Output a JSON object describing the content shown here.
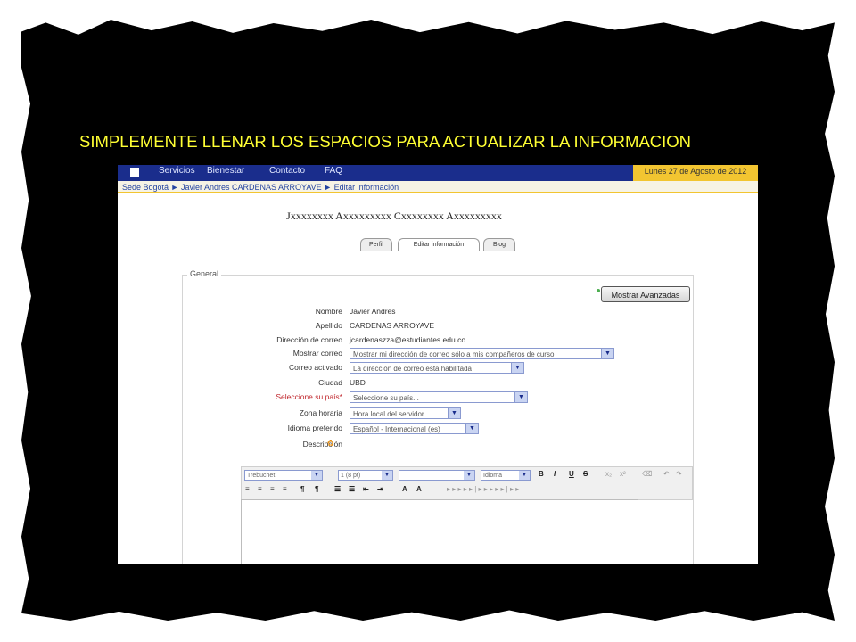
{
  "slide": {
    "title": "SIMPLEMENTE LLENAR LOS ESPACIOS PARA ACTUALIZAR LA INFORMACION",
    "title_color": "#ffff33",
    "frame_color": "#000000"
  },
  "app": {
    "nav": [
      "Servicios",
      "Bienestar",
      "Contacto",
      "FAQ"
    ],
    "date": "Lunes 27 de Agosto de 2012",
    "breadcrumb": "Sede Bogotá ► Javier Andres CARDENAS ARROYAVE ► Editar información",
    "full_name": "Jxxxxxxxx Axxxxxxxxx Cxxxxxxxx Axxxxxxxxx",
    "tabs": [
      "Perfil",
      "Editar información",
      "Blog"
    ],
    "accent_color": "#1a2d8c",
    "highlight_color": "#f2c531"
  },
  "form": {
    "legend": "General",
    "advanced_button": "Mostrar Avanzadas",
    "fields": {
      "nombre_label": "Nombre",
      "nombre_value": "Javier Andres",
      "apellido_label": "Apellido",
      "apellido_value": "CARDENAS ARROYAVE",
      "correo_label": "Dirección de correo",
      "correo_value": "jcardenaszza@estudiantes.edu.co",
      "mostrar_correo_label": "Mostrar correo",
      "mostrar_correo_value": "Mostrar mi dirección de correo sólo a mis compañeros de curso",
      "correo_activado_label": "Correo activado",
      "correo_activado_value": "La dirección de correo está habilitada",
      "ciudad_label": "Ciudad",
      "ciudad_value": "UBD",
      "pais_label": "Seleccione su país*",
      "pais_value": "Seleccione su país...",
      "zona_label": "Zona horaria",
      "zona_value": "Hora local del servidor",
      "idioma_label": "Idioma preferido",
      "idioma_value": "Español - Internacional (es)",
      "descripcion_label": "Descripción"
    }
  },
  "editor": {
    "font_family": "Trebuchet",
    "font_size": "1 (8 pt)",
    "format": "",
    "language": "Idioma",
    "bold": "B",
    "italic": "I",
    "underline": "U",
    "strike": "S"
  }
}
